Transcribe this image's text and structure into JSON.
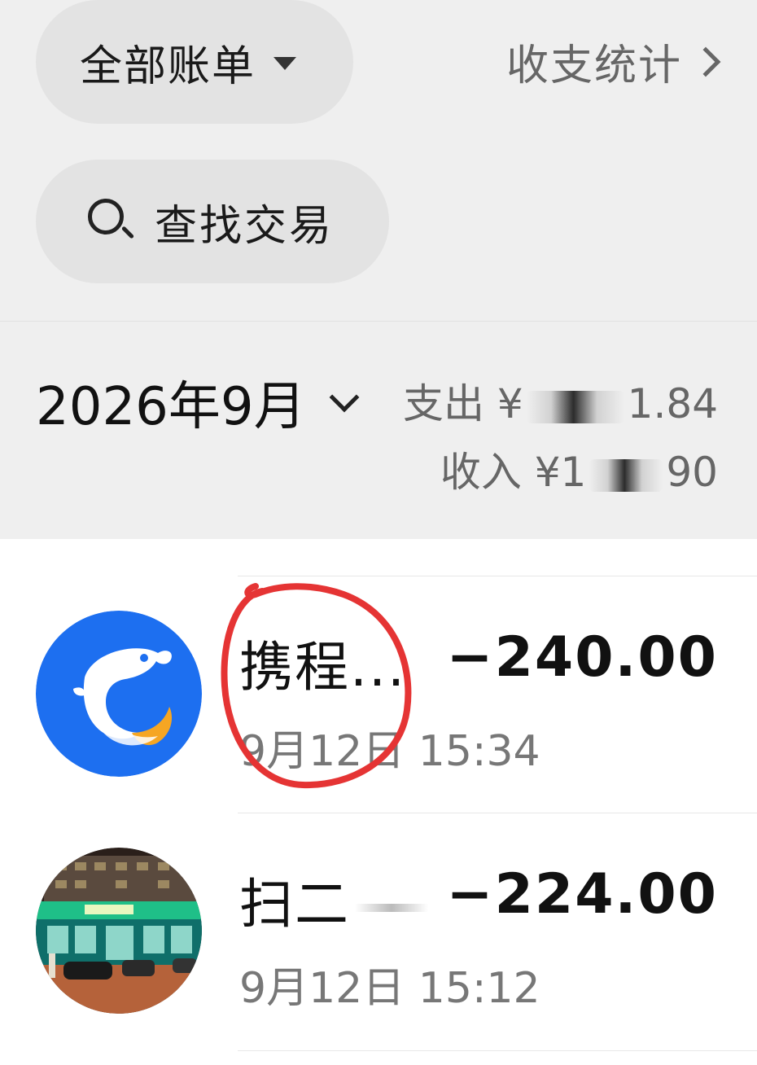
{
  "header": {
    "bills_filter_label": "全部账单",
    "stats_link_label": "收支统计",
    "search_label": "查找交易"
  },
  "period": {
    "month_label": "2026年9月",
    "expense_prefix": "支出 ¥",
    "expense_visible_suffix": "1.84",
    "income_prefix": "收入 ¥1",
    "income_visible_suffix": "90"
  },
  "transactions": [
    {
      "merchant": "携程...",
      "amount": "−240.00",
      "time": "9月12日 15:34",
      "avatar_icon": "ctrip-dolphin-logo-icon"
    },
    {
      "merchant": "扫二",
      "amount": "−224.00",
      "time": "9月12日 15:12",
      "avatar_icon": "storefront-photo"
    }
  ],
  "colors": {
    "header_background": "#efefef",
    "pill_background": "#e3e3e3",
    "ctrip_blue": "#1d6ff0",
    "ctrip_orange": "#f6a623",
    "annotation_red": "#e53434"
  }
}
